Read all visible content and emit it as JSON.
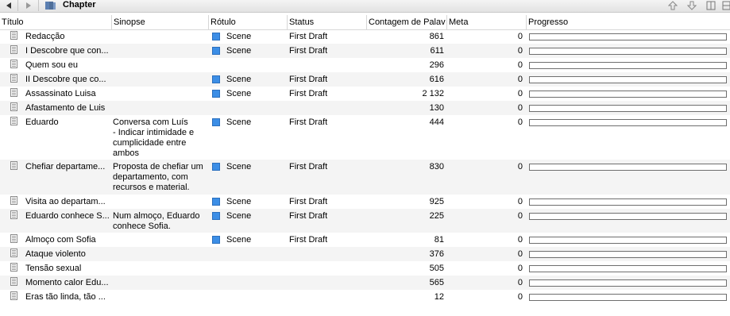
{
  "toolbar": {
    "title": "Chapter"
  },
  "columns": {
    "title": "Título",
    "synopsis": "Sinopse",
    "label": "Rótulo",
    "status": "Status",
    "word_count": "Contagem de Palav",
    "target": "Meta",
    "progress": "Progresso"
  },
  "rows": [
    {
      "title": "Redacção",
      "synopsis": "",
      "label": "Scene",
      "status": "First Draft",
      "count": "861",
      "target": "0",
      "progress": 0
    },
    {
      "title": "I Descobre que con...",
      "synopsis": "",
      "label": "Scene",
      "status": "First Draft",
      "count": "611",
      "target": "0",
      "progress": 0
    },
    {
      "title": "Quem sou eu",
      "synopsis": "",
      "label": "",
      "status": "",
      "count": "296",
      "target": "0",
      "progress": 0
    },
    {
      "title": "II Descobre que co...",
      "synopsis": "",
      "label": "Scene",
      "status": "First Draft",
      "count": "616",
      "target": "0",
      "progress": 0
    },
    {
      "title": "Assassinato Luisa",
      "synopsis": "",
      "label": "Scene",
      "status": "First Draft",
      "count": "2 132",
      "target": "0",
      "progress": 0
    },
    {
      "title": "Afastamento de Luis",
      "synopsis": "",
      "label": "",
      "status": "",
      "count": "130",
      "target": "0",
      "progress": 0
    },
    {
      "title": "Eduardo",
      "synopsis": "Conversa com Luís\n- Indicar intimidade e cumplicidade entre ambos",
      "label": "Scene",
      "status": "First Draft",
      "count": "444",
      "target": "0",
      "progress": 0
    },
    {
      "title": "Chefiar departame...",
      "synopsis": "Proposta de chefiar um departamento, com recursos e material.",
      "label": "Scene",
      "status": "First Draft",
      "count": "830",
      "target": "0",
      "progress": 0
    },
    {
      "title": "Visita ao departam...",
      "synopsis": "",
      "label": "Scene",
      "status": "First Draft",
      "count": "925",
      "target": "0",
      "progress": 0
    },
    {
      "title": "Eduardo conhece S...",
      "synopsis": "Num almoço, Eduardo conhece Sofia.",
      "label": "Scene",
      "status": "First Draft",
      "count": "225",
      "target": "0",
      "progress": 0
    },
    {
      "title": "Almoço com Sofia",
      "synopsis": "",
      "label": "Scene",
      "status": "First Draft",
      "count": "81",
      "target": "0",
      "progress": 0
    },
    {
      "title": "Ataque violento",
      "synopsis": "",
      "label": "",
      "status": "",
      "count": "376",
      "target": "0",
      "progress": 0
    },
    {
      "title": "Tensão sexual",
      "synopsis": "",
      "label": "",
      "status": "",
      "count": "505",
      "target": "0",
      "progress": 0
    },
    {
      "title": "Momento calor Edu...",
      "synopsis": "",
      "label": "",
      "status": "",
      "count": "565",
      "target": "0",
      "progress": 0
    },
    {
      "title": "Eras tão linda, tão ...",
      "synopsis": "",
      "label": "",
      "status": "",
      "count": "12",
      "target": "0",
      "progress": 0
    }
  ],
  "colors": {
    "label_scene": "#3c8ee6",
    "row_alt": "#f4f4f4"
  }
}
